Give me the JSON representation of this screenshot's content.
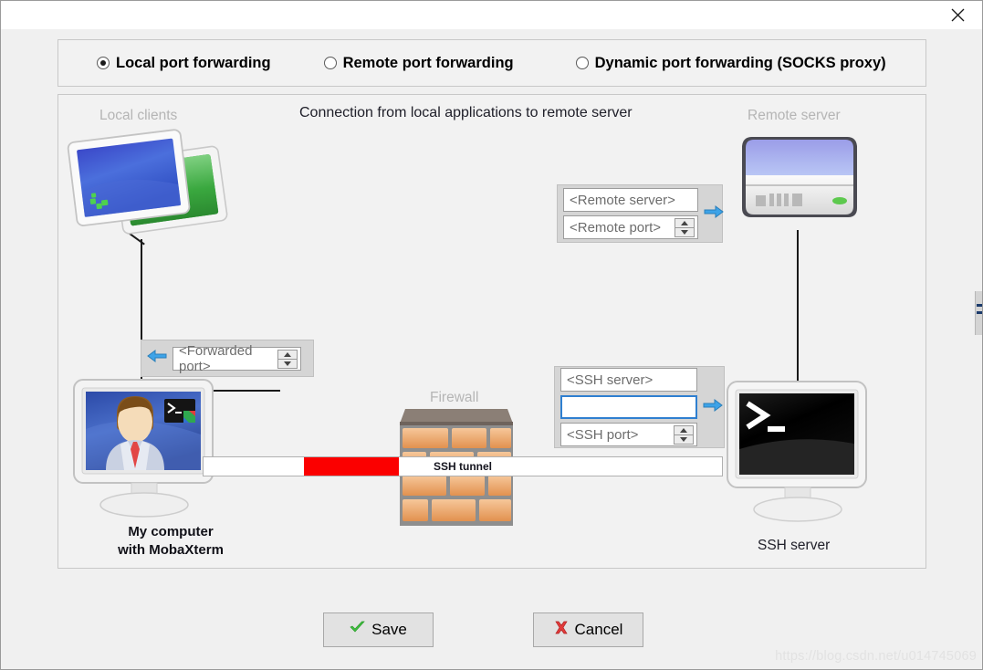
{
  "window": {
    "close_icon": "close-icon"
  },
  "modes": {
    "items": [
      {
        "label": "Local port forwarding",
        "selected": true
      },
      {
        "label": "Remote port forwarding",
        "selected": false
      },
      {
        "label": "Dynamic port forwarding (SOCKS proxy)",
        "selected": false
      }
    ]
  },
  "diagram": {
    "title": "Connection from local applications to remote server",
    "labels": {
      "local_clients": "Local clients",
      "remote_server": "Remote server",
      "firewall": "Firewall",
      "ssh_server": "SSH server",
      "my_computer_line1": "My computer",
      "my_computer_line2": "with MobaXterm",
      "ssh_tunnel": "SSH tunnel"
    },
    "remote_group": {
      "server_placeholder": "<Remote server>",
      "server_value": "",
      "port_placeholder": "<Remote port>",
      "port_value": "",
      "arrow_icon": "arrow-right-icon"
    },
    "forwarded_group": {
      "arrow_icon": "arrow-left-icon",
      "port_placeholder": "<Forwarded port>",
      "port_value": ""
    },
    "ssh_group": {
      "server_placeholder": "<SSH server>",
      "server_value": "",
      "user_placeholder": "",
      "user_value": "",
      "user_focused": true,
      "port_placeholder": "<SSH port>",
      "port_value": "",
      "arrow_icon": "arrow-right-icon"
    }
  },
  "footer": {
    "save_label": "Save",
    "save_icon": "green-check-icon",
    "cancel_label": "Cancel",
    "cancel_icon": "red-cross-icon"
  },
  "watermark": "https://blog.csdn.net/u014745069",
  "colors": {
    "accent_blue": "#2f7fd0",
    "tunnel_red": "#fb0000",
    "panel_bg": "#f2f2f2",
    "field_group_bg": "#d5d5d5",
    "dim_text": "#b5b5b5"
  }
}
